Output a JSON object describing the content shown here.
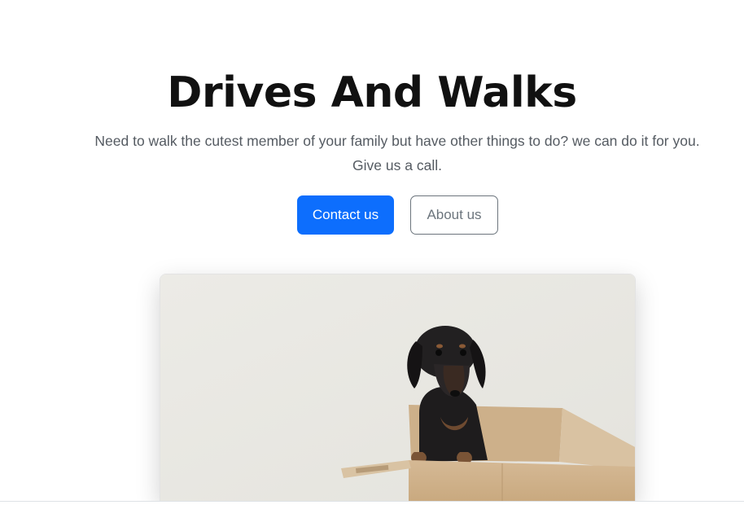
{
  "hero": {
    "title": "Drives And Walks",
    "lead": "Need to walk the cutest member of your family but have other things to do? we can do it for you. Give us a call.",
    "primary_button": "Contact us",
    "secondary_button": "About us"
  },
  "image": {
    "subject": "dachshund-in-cardboard-box"
  },
  "colors": {
    "primary": "#0d6efd",
    "secondary": "#6c757d",
    "title": "#111111"
  }
}
